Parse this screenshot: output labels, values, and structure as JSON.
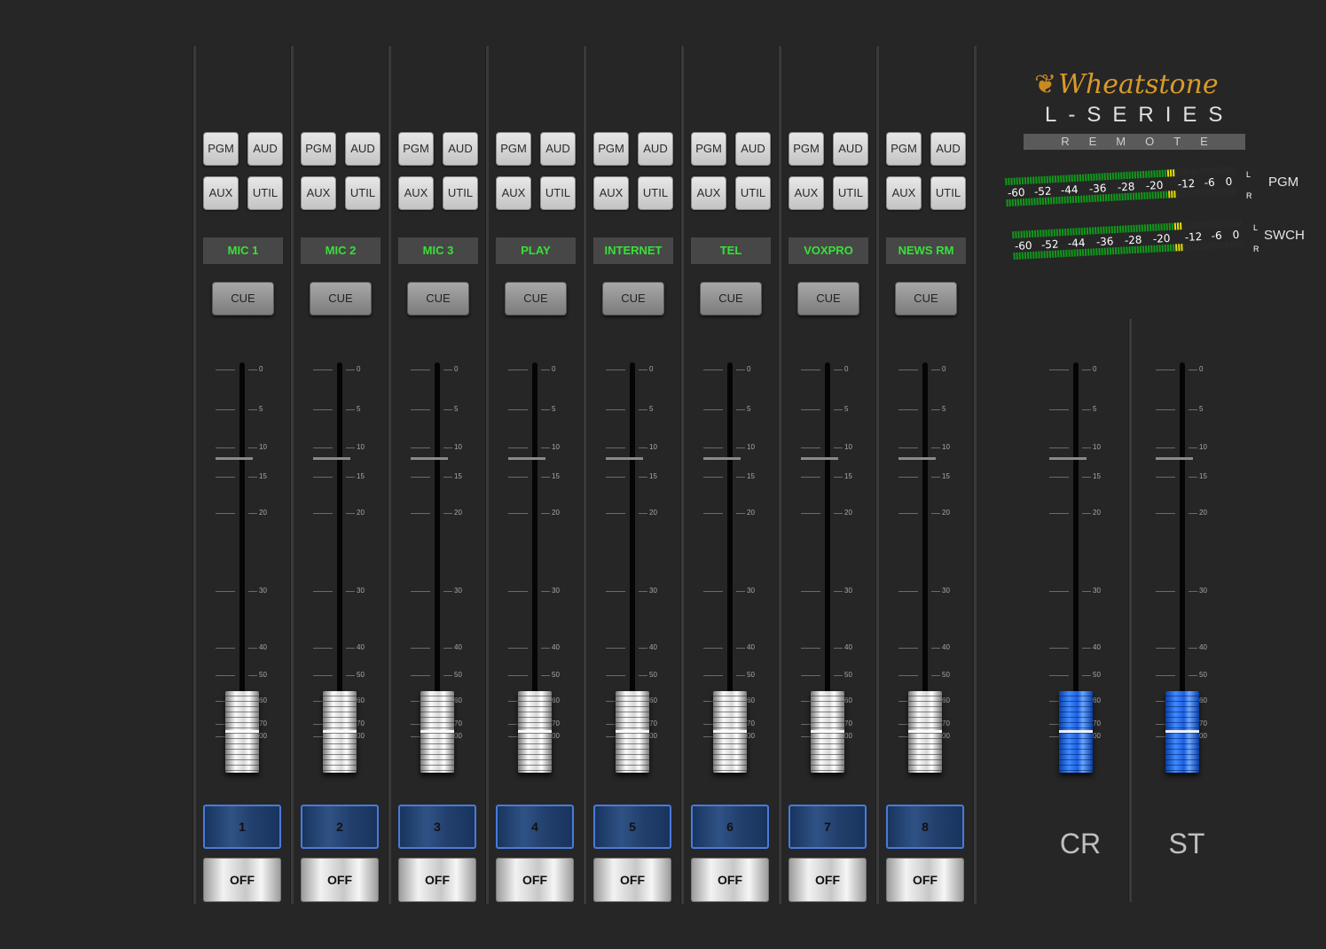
{
  "brand": {
    "logo": "Wheatstone",
    "series": "L-SERIES",
    "subtitle": "REMOTE"
  },
  "meters": [
    {
      "name": "PGM",
      "scale": [
        "-60",
        "-52",
        "-44",
        "-36",
        "-28",
        "-20",
        "-12",
        "-6",
        "0"
      ],
      "left_label": "L",
      "right_label": "R"
    },
    {
      "name": "SWCH",
      "scale": [
        "-60",
        "-52",
        "-44",
        "-36",
        "-28",
        "-20",
        "-12",
        "-6",
        "0"
      ],
      "left_label": "L",
      "right_label": "R"
    }
  ],
  "bus_buttons": [
    "PGM",
    "AUD",
    "AUX",
    "UTIL"
  ],
  "cue_label": "CUE",
  "off_label": "OFF",
  "fader_scale": [
    "0",
    "5",
    "10",
    "15",
    "20",
    "30",
    "40",
    "50",
    "60",
    "70",
    "00"
  ],
  "channels": [
    {
      "label": "MIC 1",
      "number": "1"
    },
    {
      "label": "MIC 2",
      "number": "2"
    },
    {
      "label": "MIC 3",
      "number": "3"
    },
    {
      "label": "PLAY",
      "number": "4"
    },
    {
      "label": "INTERNET",
      "number": "5"
    },
    {
      "label": "TEL",
      "number": "6"
    },
    {
      "label": "VOXPRO",
      "number": "7"
    },
    {
      "label": "NEWS RM",
      "number": "8"
    }
  ],
  "masters": [
    {
      "label": "CR"
    },
    {
      "label": "ST"
    }
  ],
  "colors": {
    "background": "#262626",
    "label_text": "#39e039",
    "logo": "#d89a2a",
    "master_cap": "#2f7bff",
    "channel_button_border": "#4b7ad8"
  }
}
